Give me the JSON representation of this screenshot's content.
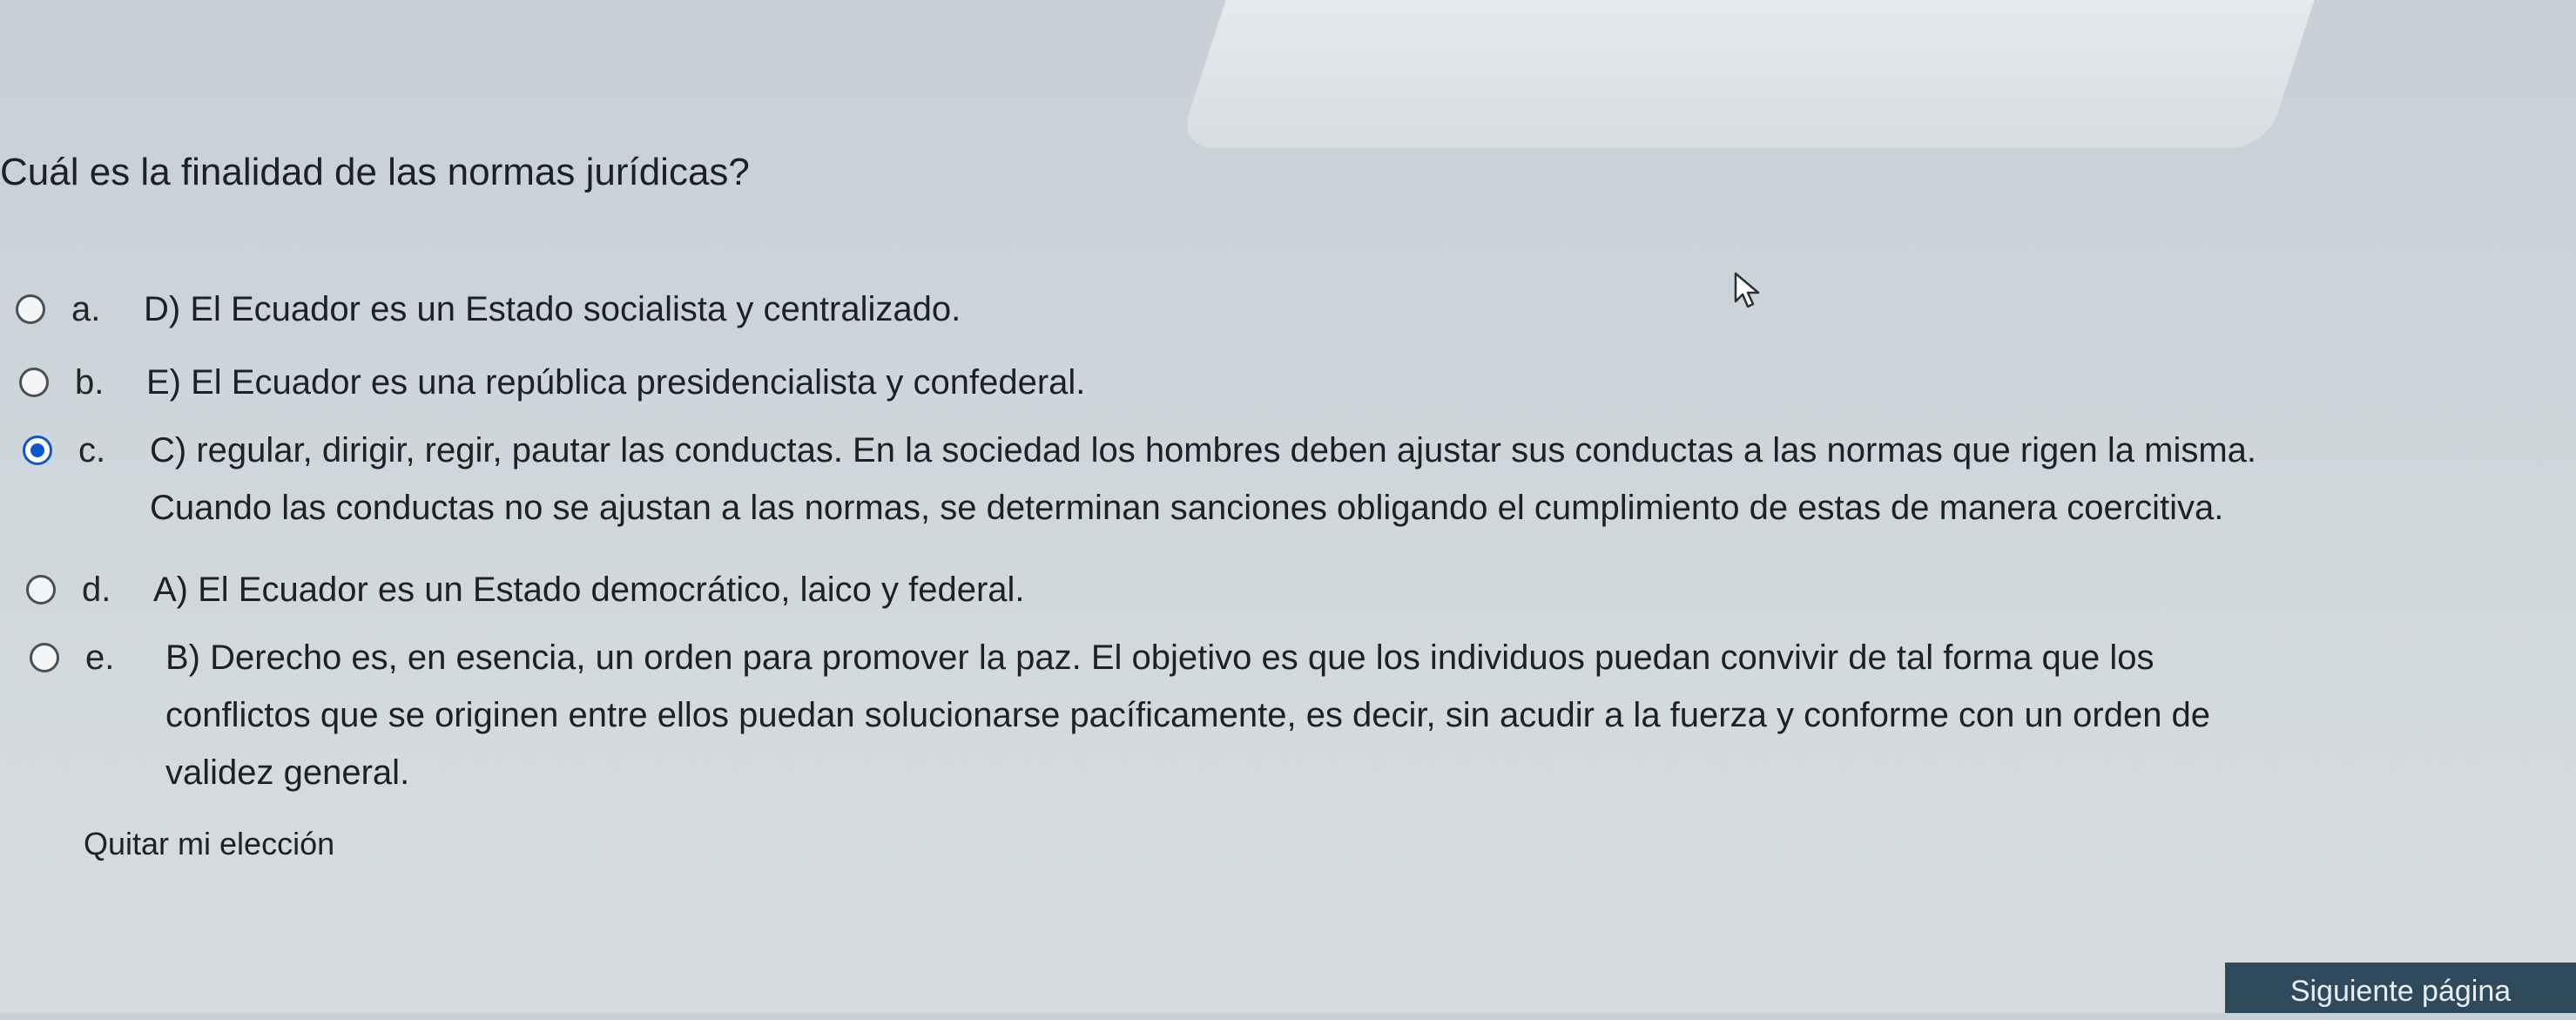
{
  "question": {
    "text": "Cuál es la finalidad de las normas jurídicas?"
  },
  "options": [
    {
      "letter": "a.",
      "text": "D) El Ecuador es un Estado socialista y centralizado.",
      "selected": false
    },
    {
      "letter": "b.",
      "text": "E) El Ecuador es una república presidencialista y confederal.",
      "selected": false
    },
    {
      "letter": "c.",
      "text": "C) regular, dirigir, regir, pautar las conductas. En la sociedad los hombres deben ajustar sus conductas a las normas que rigen la misma.\nCuando las conductas no se ajustan a las normas, se determinan sanciones obligando el cumplimiento de estas de manera coercitiva.",
      "selected": true
    },
    {
      "letter": "d.",
      "text": "A) El Ecuador es un Estado democrático, laico y federal.",
      "selected": false
    },
    {
      "letter": "e.",
      "text": "B) Derecho es, en esencia, un orden para promover la paz. El objetivo es que los individuos puedan convivir de tal forma que los\nconflictos que se originen entre ellos puedan solucionarse pacíficamente, es decir, sin acudir a la fuerza y conforme con un orden de\nvalidez general.",
      "selected": false
    }
  ],
  "actions": {
    "clear_choice": "Quitar mi elección",
    "next_page": "Siguiente página"
  },
  "colors": {
    "selected_radio": "#0b57d0",
    "next_button_bg": "#2f4a5d"
  },
  "icons": {
    "cursor": "mouse-pointer-icon"
  }
}
